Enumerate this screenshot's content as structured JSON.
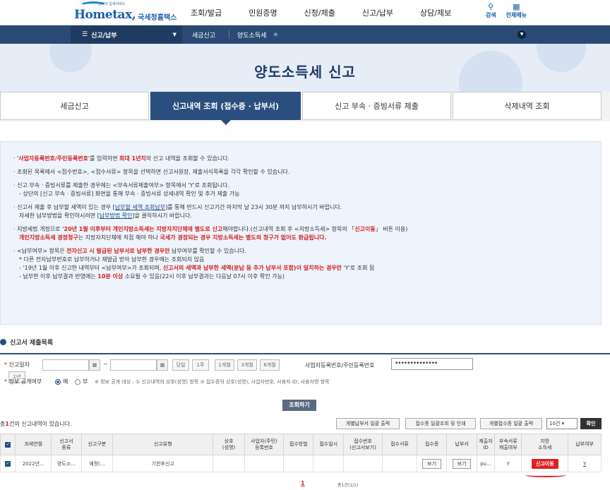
{
  "header": {
    "logo_text": "Hometax,",
    "logo_sub": "국세청홈택스",
    "logo_tag": "전자의 납세서비스",
    "gnb": [
      "조회/발급",
      "민원증명",
      "신청/제출",
      "신고/납부",
      "상담/제보"
    ],
    "search_label": "검색",
    "allmenu_label": "전체메뉴"
  },
  "nav": {
    "menu": "신고/납부",
    "crumb1": "세금신고",
    "crumb2": "양도소득세"
  },
  "banner": {
    "title": "양도소득세 신고"
  },
  "tabs": [
    {
      "label": "세금신고"
    },
    {
      "label": "신고내역 조회 (접수증 · 납부서)"
    },
    {
      "label": "신고 부속 · 증빙서류 제출"
    },
    {
      "label": "삭제내역 조회"
    }
  ],
  "notice": {
    "n1_pre": "· '",
    "n1_red1": "사업자등록번호/주민등록번호",
    "n1_mid": "'를 입력하면 ",
    "n1_red2": "최대 1년치",
    "n1_post": "의 신고 내역을 조회할 수 있습니다.",
    "n2": "· 조회된 목록에서 <접수번호>, <접수서류> 항목을 선택하면 신고서원장, 제출서식목록을 각각 확인할 수 있습니다.",
    "n3": "· 신고 부속 · 증빙서류를 제출한 경우에는 <부속서류제출여부> 항목에서 'Y'로 조회됩니다.",
    "n3_sub": "- 상단의 [신고 부속 · 증빙서류] 화면을 통해 부속 · 증빙서류 상세내역 확인 및 추가 제출 가능",
    "n4_pre": "· 신고서 제출 후 납부할 세액이 있는 경우 [",
    "n4_link1": "납부할 세액 조회납부",
    "n4_post": "]를 통해 반드시 신고기간 마지막 날 23시 30분 까지 납부하시기 바랍니다.",
    "n4b_pre": "자세한 납부방법을 확인하시려면 [",
    "n4b_link": "납부방법 확인",
    "n4b_post": "]을 클릭하시기 바랍니다.",
    "n5_pre": "· 지방세법 개정으로 ",
    "n5_red": "'20년 1월 이후부터 개인지방소득세는 지방자치단체에 별도로 신고",
    "n5_mid": "해야합니다.(신고내역 조회 후 <지방소득세> 항목의 「",
    "n5_red2": "신고이동",
    "n5_post": "」 버튼 이용)",
    "n5b_red1": "개인지방소득세 경정청구",
    "n5b_mid": "는 지방자치단체에 직접 해야 하나 ",
    "n5b_red2": "국세가 경정되는 경우 지방소득세는 별도의 청구가 없어도 환급됩니다.",
    "n6_pre": "· <납부여부> 항목은 ",
    "n6_red": "전자신고 시 발급된 납부서로 납부한 경우만",
    "n6_post": " 납부여부를 확인할 수 있습니다.",
    "n6_s1": "* 다른 전자납부번호로 납부하거나 재발급 받아 납부한 경우에는 조회되지 않음",
    "n6_s2_pre": "- '19년 1월 이후 신고한 내역부터 <납부여부>가 조회되며, ",
    "n6_s2_red": "신고서의 세액과 납부한 세액(분납 등 추가 납부서 포함)이 일치하는 경우만",
    "n6_s2_post": " 'Y'로 조회 됨",
    "n6_s3_pre": "- 납부한 이후 납부결과 반영에는 ",
    "n6_s3_red": "10분 이상",
    "n6_s3_post": " 소요될 수 있음(22시 이후 납부결과는 다음날 07시 이후 확인 가능)"
  },
  "form": {
    "section_title": "신고서 제출목록",
    "date_label": "신고일자",
    "date_sep": "~",
    "period_buttons": [
      "당일",
      "1주",
      "1개월",
      "3개월",
      "6개월",
      "1년"
    ],
    "id_label": "사업자등록번호/주민등록번호",
    "id_value": "••••••••••••••",
    "public_label": "정보 공개여부",
    "radio_yes": "예",
    "radio_no": "부",
    "public_note": "※ 정보 공개 대상 : ① 신고내역의 상호(성명) 항목 ② 접수증의 상호(성명), 사업자번호, 사용자 ID, 사용자명 항목",
    "search_btn": "조회하기"
  },
  "list": {
    "count_pre": "총",
    "count_num": "1",
    "count_post": "건의 신고내역이 있습니다.",
    "btn_print_pay": "개별납부서 일괄 출력",
    "btn_receipt": "접수증 일괄조회 및 인쇄",
    "btn_receipt_each": "개별접수증 일괄 출력",
    "page_size": "10건 ▾",
    "confirm": "확인",
    "headers": [
      "과세연월",
      "신고서\n종류",
      "신고구분",
      "신고유형",
      "상호\n(성명)",
      "사업자(주민)\n등록번호",
      "접수방법",
      "접수일시",
      "접수번호\n(신고서보기)",
      "접수서류",
      "접수증",
      "납부서",
      "제출자\nID",
      "부속서류\n제출여부",
      "지방\n소득세",
      "납부여부"
    ],
    "row": {
      "period": "2022년...",
      "kind": "양도소...",
      "gubun": "예정(...",
      "type": "기한후신고",
      "view1": "보기",
      "view2": "보기",
      "id": "pu...",
      "attach": "Y",
      "local": "신고이동",
      "paid": "Y"
    },
    "page": "1",
    "page_info": "총1건(1/1)"
  }
}
